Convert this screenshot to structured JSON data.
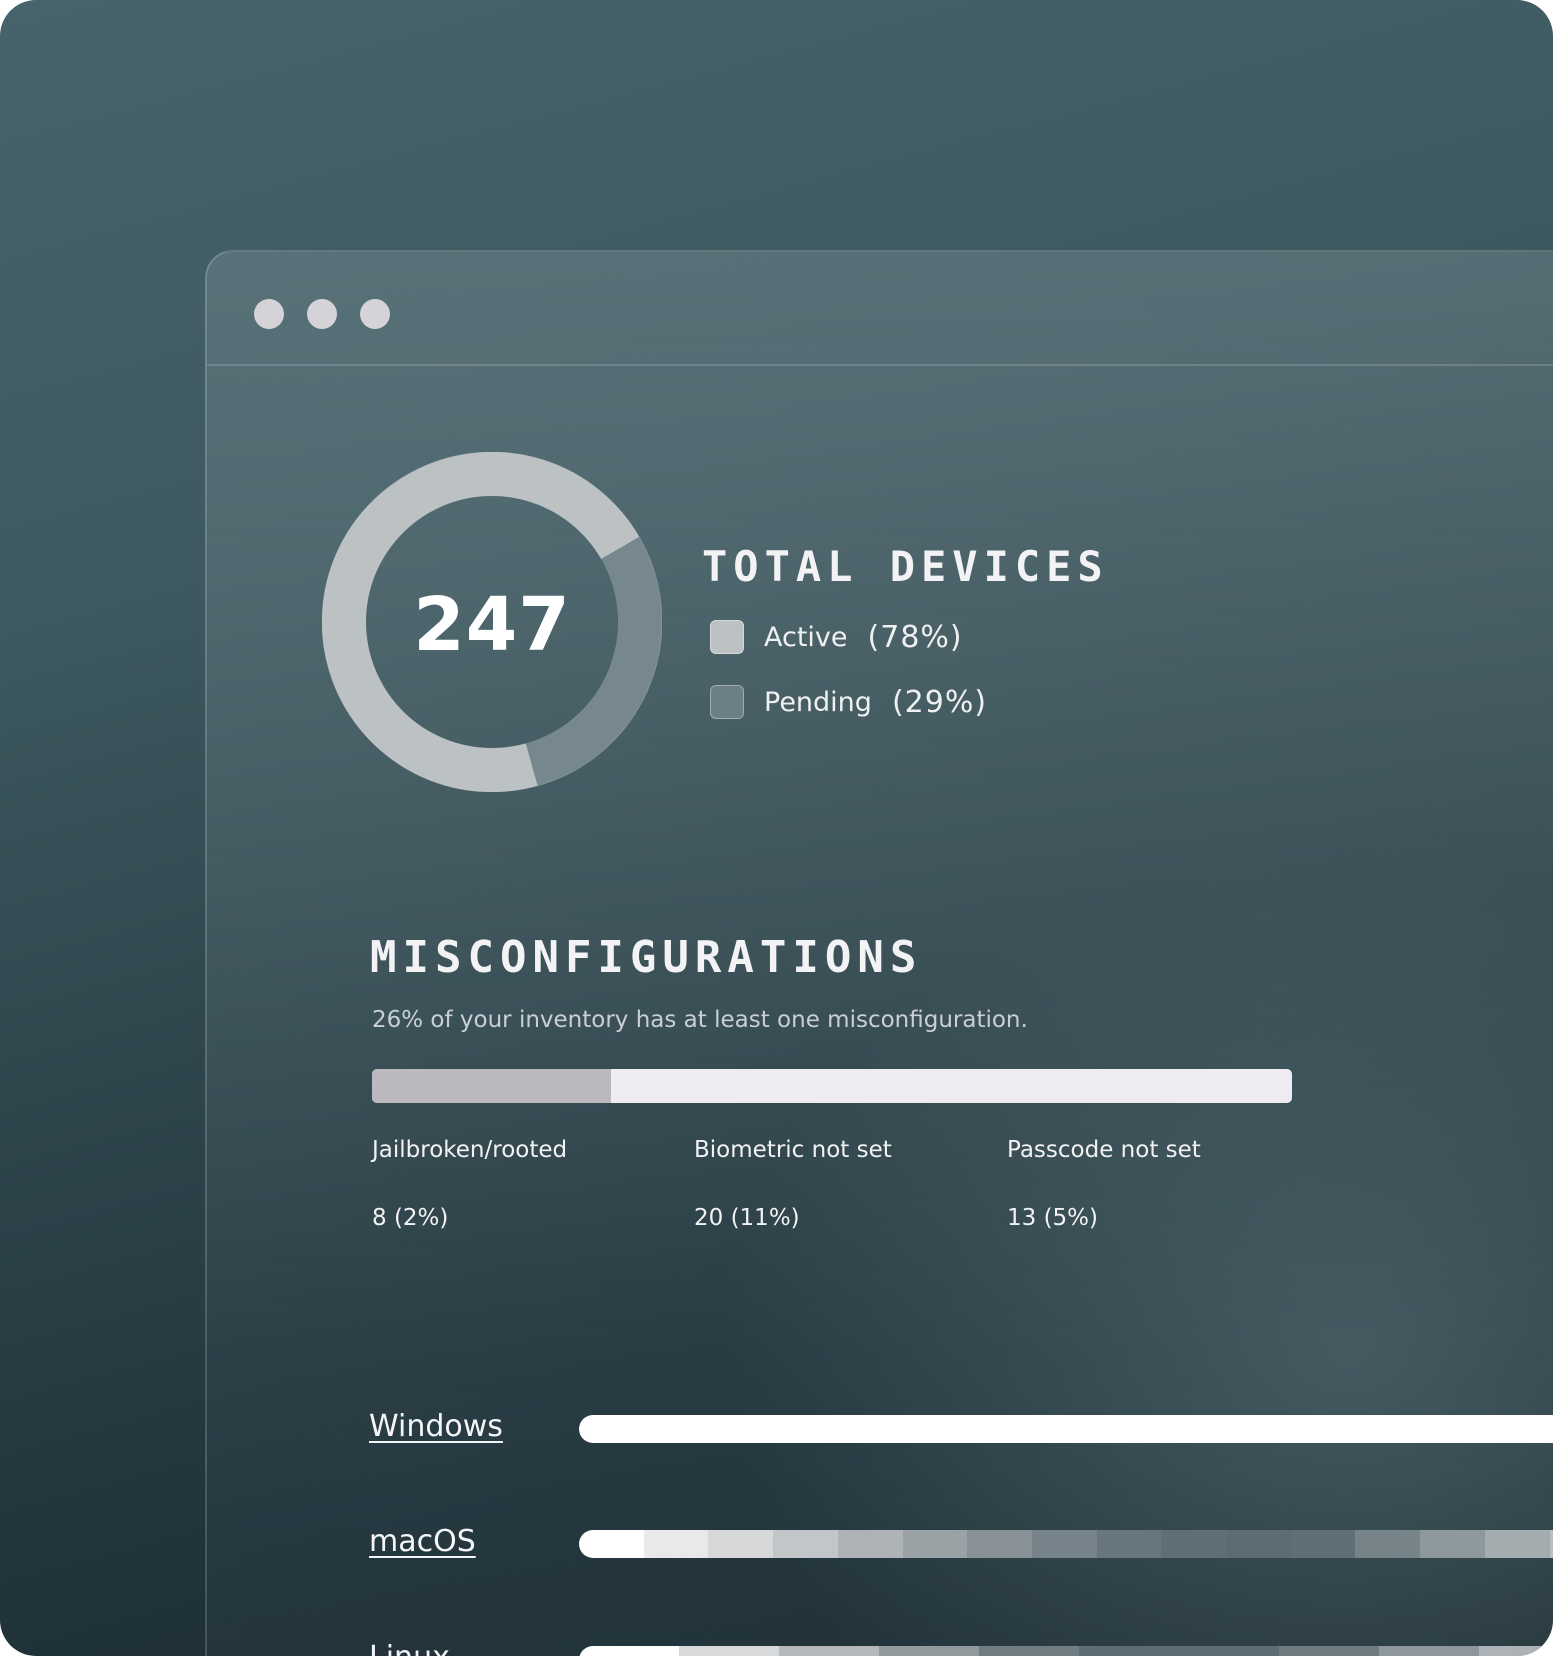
{
  "window": {
    "controls": [
      "close-dot",
      "minimize-dot",
      "maximize-dot"
    ]
  },
  "total_devices": {
    "count": "247",
    "title": "TOTAL DEVICES",
    "legend": [
      {
        "label": "Active",
        "percent": "(78%)",
        "color": "#bcc1c4"
      },
      {
        "label": "Pending",
        "percent": "(29%)",
        "color": "#6b7f85"
      }
    ],
    "donut": {
      "active_fraction": 0.71,
      "pending_fraction": 0.29,
      "active_color": "#bcc1c4",
      "pending_color": "#76888d"
    }
  },
  "misconfigurations": {
    "title": "MISCONFIGURATIONS",
    "subtitle": "26% of your inventory has at least one misconfiguration.",
    "progress_fraction": 0.26,
    "items": [
      {
        "label": "Jailbroken/rooted",
        "value": "8 (2%)"
      },
      {
        "label": "Biometric not set",
        "value": "20 (11%)"
      },
      {
        "label": "Passcode not set",
        "value": "13 (5%)"
      }
    ]
  },
  "os_breakdown": [
    {
      "name": "Windows",
      "segments": [
        "#ffffff"
      ]
    },
    {
      "name": "macOS",
      "segments": [
        "#ffffff",
        "#e9e9ec",
        "#d7d8da",
        "#c3c6c8",
        "#aeb3b6",
        "#9aa2a6",
        "#879196",
        "#76838a",
        "#68767d",
        "#5f6f76",
        "#5c6c73",
        "#5f6f76",
        "#76848a",
        "#8e999e",
        "#a4acb0",
        "#b9bec0",
        "#cfd2d4"
      ]
    },
    {
      "name": "Linux",
      "segments": [
        "#ffffff",
        "#d8d9db",
        "#b4b8ba",
        "#91999d",
        "#707e84",
        "#5e6d74",
        "#5e6d74",
        "#6f7d83",
        "#8e989c",
        "#acb2b5",
        "#cbcdcf"
      ]
    }
  ]
}
